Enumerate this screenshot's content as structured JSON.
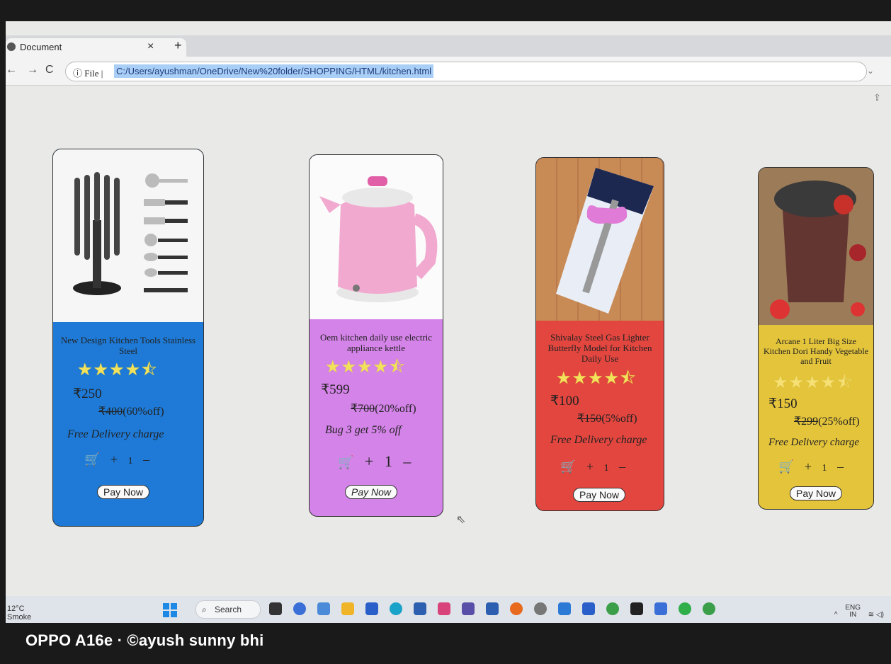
{
  "browser": {
    "tab_title": "Document",
    "tab_close": "×",
    "new_tab": "+",
    "back": "←",
    "forward": "→",
    "reload": "C",
    "info_label": "ⓘ File |",
    "url": "C:/Users/ayushman/OneDrive/New%20folder/SHOPPING/HTML/kitchen.html"
  },
  "products": [
    {
      "title": "New Design Kitchen Tools Stainless Steel",
      "rating_icon": "star-rating-icon",
      "stars": "★★★★⯪",
      "price": "₹250",
      "mrp": "₹400",
      "discount": "(60%off)",
      "offer": "Free Delivery charge",
      "qty_plus": "+",
      "qty": "1",
      "qty_minus": "–",
      "pay_label": "Pay Now",
      "color": "#1e7ad6"
    },
    {
      "title": "Oem kitchen daily use electric appliance kettle",
      "rating_icon": "star-rating-icon",
      "stars": "★★★★⯪",
      "price": "₹599",
      "mrp": "₹700",
      "discount": "(20%off)",
      "offer": "Bug 3 get 5% off",
      "qty_plus": "+",
      "qty": "1",
      "qty_minus": "–",
      "pay_label": "Pay Now",
      "color": "#d483e8"
    },
    {
      "title": "Shivalay Steel Gas Lighter Butterfly Model for Kitchen Daily Use",
      "rating_icon": "star-rating-icon",
      "stars": "★★★★⯪",
      "price": "₹100",
      "mrp": "₹150",
      "discount": "(5%off)",
      "offer": "Free Delivery charge",
      "qty_plus": "+",
      "qty": "1",
      "qty_minus": "–",
      "pay_label": "Pay Now",
      "color": "#e2463f"
    },
    {
      "title": "Arcane 1 Liter Big Size Kitchen Dori Handy Vegetable and Fruit",
      "rating_icon": "star-rating-icon",
      "stars": "★★★★⯪",
      "price": "₹150",
      "mrp": "₹299",
      "discount": "(25%off)",
      "offer": "Free Delivery charge",
      "qty_plus": "+",
      "qty": "1",
      "qty_minus": "–",
      "pay_label": "Pay Now",
      "color": "#e4c43b"
    }
  ],
  "taskbar": {
    "temp": "12°C",
    "weather": "Smoke",
    "search_label": "Search",
    "lang": "ENG",
    "region": "IN"
  },
  "watermark": "OPPO A16e · ©ayush sunny bhi"
}
